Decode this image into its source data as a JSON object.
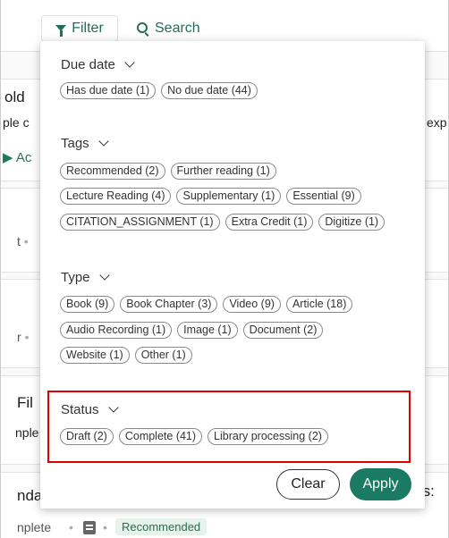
{
  "toolbar": {
    "filter_label": "Filter",
    "search_label": "Search"
  },
  "background": {
    "card1_title_fragment": "old",
    "card1_line_fragment": "ple c",
    "card1_action_fragment": "Ac",
    "card1_right_fragment": "exp",
    "card2_fragment": "t",
    "card3_fragment": "r",
    "card4_title_fragment": "Fil",
    "card4_line_fragment": "nple",
    "card5_title_fragment": "nda",
    "card5_right_fragment": "rs:",
    "bottom_status_fragment": "nplete",
    "bottom_badge": "Recommended",
    "separator": "•"
  },
  "filter_panel": {
    "groups": [
      {
        "title": "Due date",
        "chips": [
          "Has due date (1)",
          "No due date (44)"
        ]
      },
      {
        "title": "Tags",
        "chip_rows": [
          [
            "Recommended (2)",
            "Further reading (1)"
          ],
          [
            "Lecture Reading (4)",
            "Supplementary (1)",
            "Essential (9)"
          ],
          [
            "CITATION_ASSIGNMENT (1)",
            "Extra Credit (1)",
            "Digitize (1)"
          ]
        ]
      },
      {
        "title": "Type",
        "chip_rows": [
          [
            "Book (9)",
            "Book Chapter (3)",
            "Video (9)",
            "Article (18)"
          ],
          [
            "Audio Recording (1)",
            "Image (1)",
            "Document (2)"
          ],
          [
            "Website (1)",
            "Other (1)"
          ]
        ]
      },
      {
        "title": "Status",
        "chips": [
          "Draft (2)",
          "Complete (41)",
          "Library processing (2)"
        ]
      }
    ],
    "clear_label": "Clear",
    "apply_label": "Apply"
  },
  "colors": {
    "accent": "#1a7a63",
    "highlight": "#e00000"
  }
}
